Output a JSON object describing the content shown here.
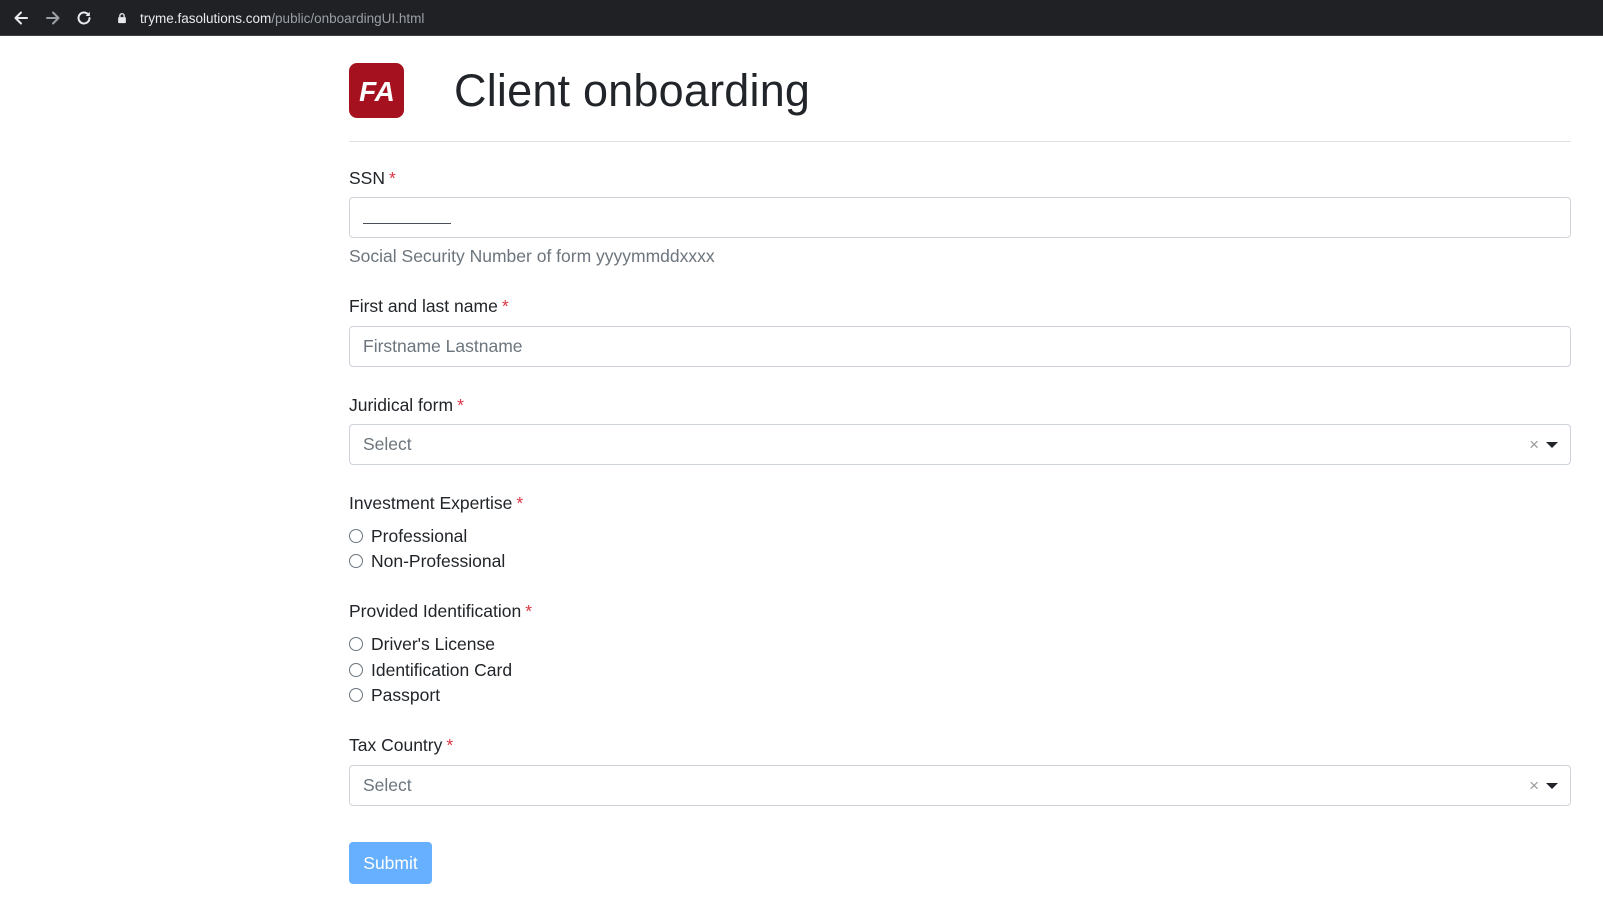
{
  "browser": {
    "url_host": "tryme.fasolutions.com",
    "url_path": "/public/onboardingUI.html"
  },
  "header": {
    "logo_text": "FA",
    "title": "Client onboarding"
  },
  "form": {
    "required_marker": "*",
    "ssn": {
      "label": "SSN",
      "help": "Social Security Number of form yyyymmddxxxx"
    },
    "name": {
      "label": "First and last name",
      "placeholder": "Firstname Lastname"
    },
    "juridical_form": {
      "label": "Juridical form",
      "placeholder": "Select",
      "clear": "×"
    },
    "investment_expertise": {
      "label": "Investment Expertise",
      "options": [
        "Professional",
        "Non-Professional"
      ]
    },
    "provided_identification": {
      "label": "Provided Identification",
      "options": [
        "Driver's License",
        "Identification Card",
        "Passport"
      ]
    },
    "tax_country": {
      "label": "Tax Country",
      "placeholder": "Select",
      "clear": "×"
    },
    "submit_label": "Submit"
  },
  "colors": {
    "logo": "#a6111f",
    "required": "#dc3545",
    "submit": "#66b0ff"
  }
}
